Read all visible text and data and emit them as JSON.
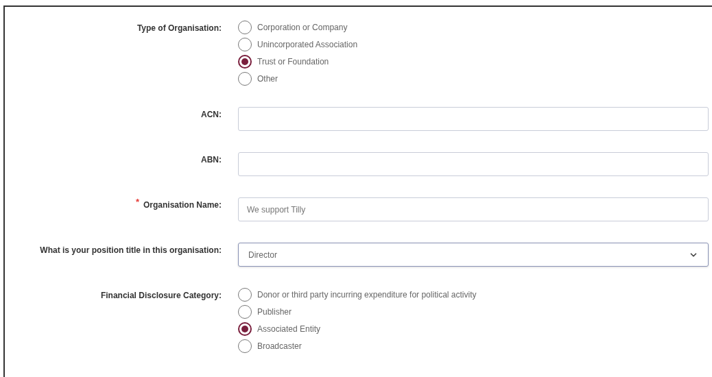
{
  "fields": [
    {
      "kind": "radio",
      "label": "Type of Organisation:",
      "options": [
        {
          "label": "Corporation or Company",
          "selected": false
        },
        {
          "label": "Unincorporated Association",
          "selected": false
        },
        {
          "label": "Trust or Foundation",
          "selected": true
        },
        {
          "label": "Other",
          "selected": false
        }
      ]
    },
    {
      "kind": "text",
      "label": "ACN:"
    },
    {
      "kind": "text",
      "label": "ABN:"
    },
    {
      "kind": "text",
      "label": "Organisation Name:",
      "required_mark": "*",
      "value": "We support Tilly"
    },
    {
      "kind": "select",
      "label": "What is your position title in this organisation:",
      "value": "Director"
    },
    {
      "kind": "radio",
      "label": "Financial Disclosure Category:",
      "options": [
        {
          "label": "Donor or third party incurring expenditure for political activity",
          "selected": false
        },
        {
          "label": "Publisher",
          "selected": false
        },
        {
          "label": "Associated Entity",
          "selected": true
        },
        {
          "label": "Broadcaster",
          "selected": false
        }
      ]
    }
  ]
}
